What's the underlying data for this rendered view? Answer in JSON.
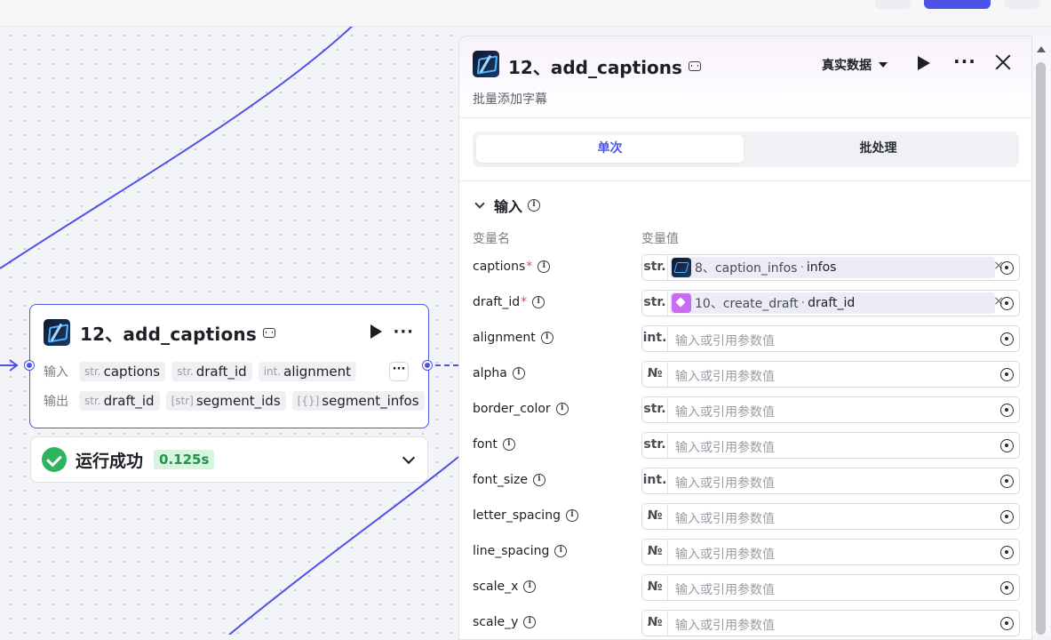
{
  "node": {
    "title": "12、add_captions",
    "input_label": "输入",
    "output_label": "输出",
    "inputs": [
      {
        "type": "str.",
        "name": "captions"
      },
      {
        "type": "str.",
        "name": "draft_id"
      },
      {
        "type": "int.",
        "name": "alignment"
      }
    ],
    "outputs": [
      {
        "type": "str.",
        "name": "draft_id"
      },
      {
        "type": "[str]",
        "name": "segment_ids"
      },
      {
        "type": "[{}]",
        "name": "segment_infos"
      }
    ],
    "more": "···"
  },
  "status": {
    "text": "运行成功",
    "time": "0.125s"
  },
  "panel": {
    "title": "12、add_captions",
    "description": "批量添加字幕",
    "data_mode": "真实数据",
    "tabs": [
      "单次",
      "批处理"
    ],
    "section": "输入",
    "col_name": "变量名",
    "col_value": "变量值",
    "placeholder": "输入或引用参数值",
    "params": [
      {
        "name": "captions",
        "required": "*",
        "type": "str.",
        "ref": {
          "node": "8、caption_infos",
          "field": "infos",
          "icon": "app"
        }
      },
      {
        "name": "draft_id",
        "required": "*",
        "type": "str.",
        "ref": {
          "node": "10、create_draft",
          "field": "draft_id",
          "icon": "cube"
        }
      },
      {
        "name": "alignment",
        "type": "int."
      },
      {
        "name": "alpha",
        "type": "№"
      },
      {
        "name": "border_color",
        "type": "str."
      },
      {
        "name": "font",
        "type": "str."
      },
      {
        "name": "font_size",
        "type": "int."
      },
      {
        "name": "letter_spacing",
        "type": "№"
      },
      {
        "name": "line_spacing",
        "type": "№"
      },
      {
        "name": "scale_x",
        "type": "№"
      },
      {
        "name": "scale_y",
        "type": "№"
      }
    ]
  },
  "colors": {
    "accent": "#4d53e8",
    "success": "#2eb35f",
    "required": "#e5484d"
  }
}
